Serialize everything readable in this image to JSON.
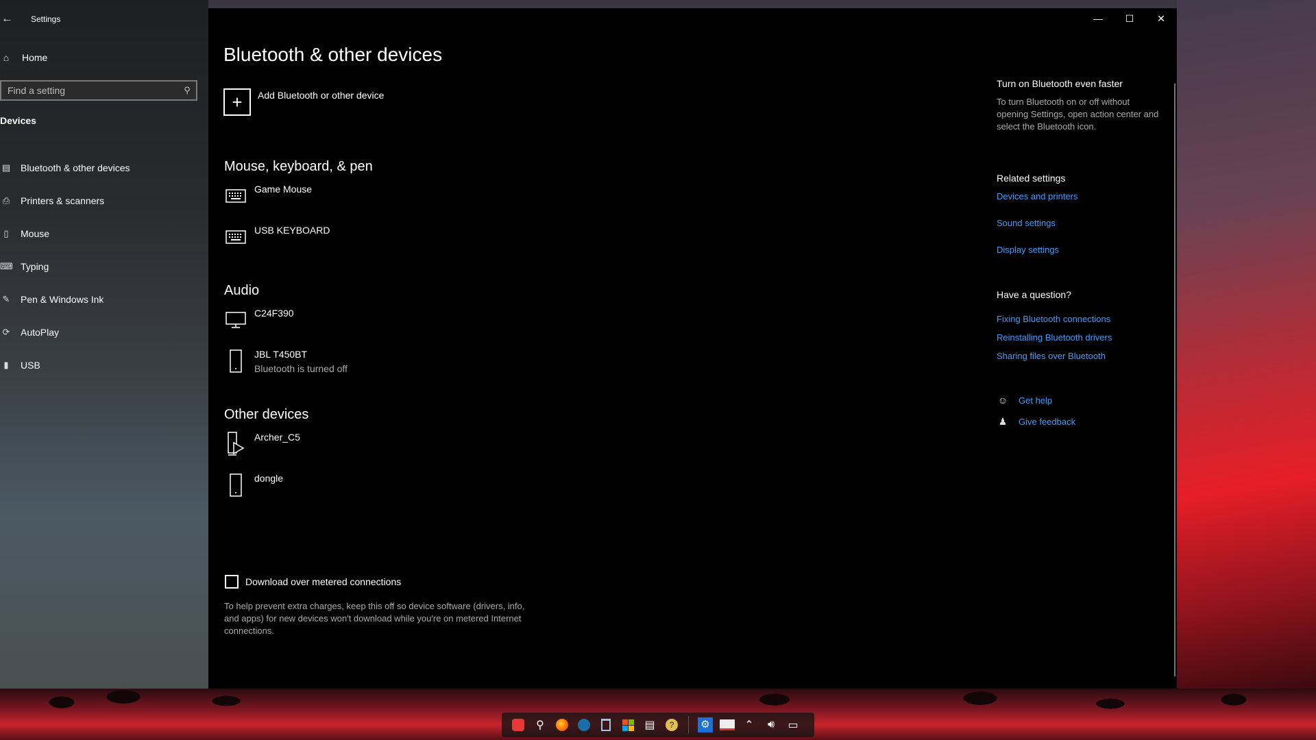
{
  "app": {
    "title": "Settings"
  },
  "sidebar": {
    "home_label": "Home",
    "search_placeholder": "Find a setting",
    "section_label": "Devices",
    "items": [
      {
        "label": "Bluetooth & other devices",
        "icon": "bluetooth-icon"
      },
      {
        "label": "Printers & scanners",
        "icon": "printer-icon"
      },
      {
        "label": "Mouse",
        "icon": "mouse-icon"
      },
      {
        "label": "Typing",
        "icon": "keyboard-icon"
      },
      {
        "label": "Pen & Windows Ink",
        "icon": "pen-icon"
      },
      {
        "label": "AutoPlay",
        "icon": "autoplay-icon"
      },
      {
        "label": "USB",
        "icon": "usb-icon"
      }
    ]
  },
  "main": {
    "title": "Bluetooth & other devices",
    "add_device_label": "Add Bluetooth or other device",
    "groups": [
      {
        "title": "Mouse, keyboard, & pen",
        "devices": [
          {
            "name": "Game Mouse",
            "status": "",
            "icon": "keyboard-icon"
          },
          {
            "name": "USB KEYBOARD",
            "status": "",
            "icon": "keyboard-icon"
          }
        ]
      },
      {
        "title": "Audio",
        "devices": [
          {
            "name": "C24F390",
            "status": "",
            "icon": "monitor-icon"
          },
          {
            "name": "JBL T450BT",
            "status": "Bluetooth is turned off",
            "icon": "phone-icon"
          }
        ]
      },
      {
        "title": "Other devices",
        "devices": [
          {
            "name": "Archer_C5",
            "status": "",
            "icon": "media-device-icon"
          },
          {
            "name": "dongle",
            "status": "",
            "icon": "phone-icon"
          }
        ]
      }
    ],
    "metered": {
      "label": "Download over metered connections",
      "checked": false,
      "description": "To help prevent extra charges, keep this off so device software (drivers, info, and apps) for new devices won't download while you're on metered Internet connections."
    }
  },
  "rail": {
    "faster_title": "Turn on Bluetooth even faster",
    "faster_text": "To turn Bluetooth on or off without opening Settings, open action center and select the Bluetooth icon.",
    "related_title": "Related settings",
    "related_links": [
      "Devices and printers",
      "Sound settings",
      "Display settings"
    ],
    "question_title": "Have a question?",
    "question_links": [
      "Fixing Bluetooth connections",
      "Reinstalling Bluetooth drivers",
      "Sharing files over Bluetooth"
    ],
    "get_help": "Get help",
    "give_feedback": "Give feedback"
  },
  "colors": {
    "link": "#3aa0ff",
    "background": "#000000"
  },
  "taskbar": {
    "icons": [
      "start-icon",
      "search-icon",
      "firefox-icon",
      "steam-icon",
      "recycle-bin-icon",
      "store-icon",
      "notes-icon",
      "help-icon",
      "settings-icon",
      "window-icon",
      "chevron-up-icon",
      "volume-icon",
      "action-center-icon"
    ]
  }
}
